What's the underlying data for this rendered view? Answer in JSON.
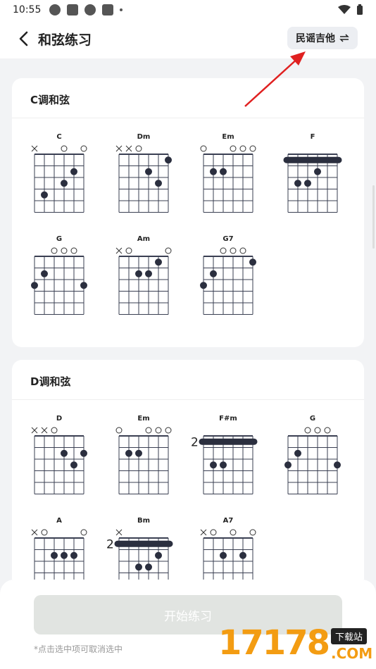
{
  "status": {
    "time": "10:55"
  },
  "header": {
    "title": "和弦练习",
    "mode_label": "民谣吉他",
    "mode_icon": "swap-icon"
  },
  "sections": [
    {
      "title": "C调和弦",
      "chords": [
        {
          "name": "C",
          "top": [
            "x",
            "",
            "",
            "o",
            "",
            "o"
          ],
          "dots": [
            [
              2,
              5
            ],
            [
              3,
              4
            ],
            [
              4,
              2
            ]
          ],
          "barre": null,
          "fret_label": ""
        },
        {
          "name": "Dm",
          "top": [
            "x",
            "x",
            "o",
            "",
            "",
            ""
          ],
          "dots": [
            [
              1,
              6
            ],
            [
              2,
              4
            ],
            [
              3,
              5
            ]
          ],
          "barre": null,
          "fret_label": ""
        },
        {
          "name": "Em",
          "top": [
            "o",
            "",
            "",
            "o",
            "o",
            "o"
          ],
          "dots": [
            [
              2,
              2
            ],
            [
              2,
              3
            ]
          ],
          "barre": null,
          "fret_label": ""
        },
        {
          "name": "F",
          "top": [
            "",
            "",
            "",
            "",
            "",
            ""
          ],
          "dots": [
            [
              2,
              4
            ],
            [
              3,
              2
            ],
            [
              3,
              3
            ]
          ],
          "barre": 1,
          "fret_label": ""
        },
        {
          "name": "G",
          "top": [
            "",
            "",
            "o",
            "o",
            "o",
            ""
          ],
          "dots": [
            [
              2,
              2
            ],
            [
              3,
              1
            ],
            [
              3,
              6
            ]
          ],
          "barre": null,
          "fret_label": ""
        },
        {
          "name": "Am",
          "top": [
            "x",
            "o",
            "",
            "",
            "",
            "o"
          ],
          "dots": [
            [
              1,
              5
            ],
            [
              2,
              3
            ],
            [
              2,
              4
            ]
          ],
          "barre": null,
          "fret_label": ""
        },
        {
          "name": "G7",
          "top": [
            "",
            "",
            "o",
            "o",
            "o",
            ""
          ],
          "dots": [
            [
              1,
              6
            ],
            [
              2,
              2
            ],
            [
              3,
              1
            ]
          ],
          "barre": null,
          "fret_label": ""
        }
      ]
    },
    {
      "title": "D调和弦",
      "chords": [
        {
          "name": "D",
          "top": [
            "x",
            "x",
            "o",
            "",
            "",
            ""
          ],
          "dots": [
            [
              2,
              4
            ],
            [
              2,
              6
            ],
            [
              3,
              5
            ]
          ],
          "barre": null,
          "fret_label": ""
        },
        {
          "name": "Em",
          "top": [
            "o",
            "",
            "",
            "o",
            "o",
            "o"
          ],
          "dots": [
            [
              2,
              2
            ],
            [
              2,
              3
            ]
          ],
          "barre": null,
          "fret_label": ""
        },
        {
          "name": "F#m",
          "top": [
            "",
            "",
            "",
            "",
            "",
            ""
          ],
          "dots": [
            [
              3,
              2
            ],
            [
              3,
              3
            ]
          ],
          "barre": 1,
          "fret_label": "2"
        },
        {
          "name": "G",
          "top": [
            "",
            "",
            "o",
            "o",
            "o",
            ""
          ],
          "dots": [
            [
              2,
              2
            ],
            [
              3,
              1
            ],
            [
              3,
              6
            ]
          ],
          "barre": null,
          "fret_label": ""
        },
        {
          "name": "A",
          "top": [
            "x",
            "o",
            "",
            "",
            "",
            "o"
          ],
          "dots": [
            [
              2,
              3
            ],
            [
              2,
              4
            ],
            [
              2,
              5
            ]
          ],
          "barre": null,
          "fret_label": ""
        },
        {
          "name": "Bm",
          "top": [
            "x",
            "",
            "",
            "",
            "",
            ""
          ],
          "dots": [
            [
              2,
              5
            ],
            [
              3,
              3
            ],
            [
              3,
              4
            ]
          ],
          "barre": 1,
          "fret_label": "2"
        },
        {
          "name": "A7",
          "top": [
            "x",
            "o",
            "",
            "o",
            "",
            "o"
          ],
          "dots": [
            [
              2,
              3
            ],
            [
              2,
              5
            ]
          ],
          "barre": null,
          "fret_label": ""
        }
      ]
    }
  ],
  "footer": {
    "start_label": "开始练习",
    "hint": "*点击选中项可取消选中"
  },
  "watermark": {
    "digits": "17178",
    "badge": "下载站",
    "suffix": ".COM"
  },
  "colors": {
    "dot": "#2b2f3f",
    "grid": "#3a3f52",
    "arrow": "#e02020"
  }
}
